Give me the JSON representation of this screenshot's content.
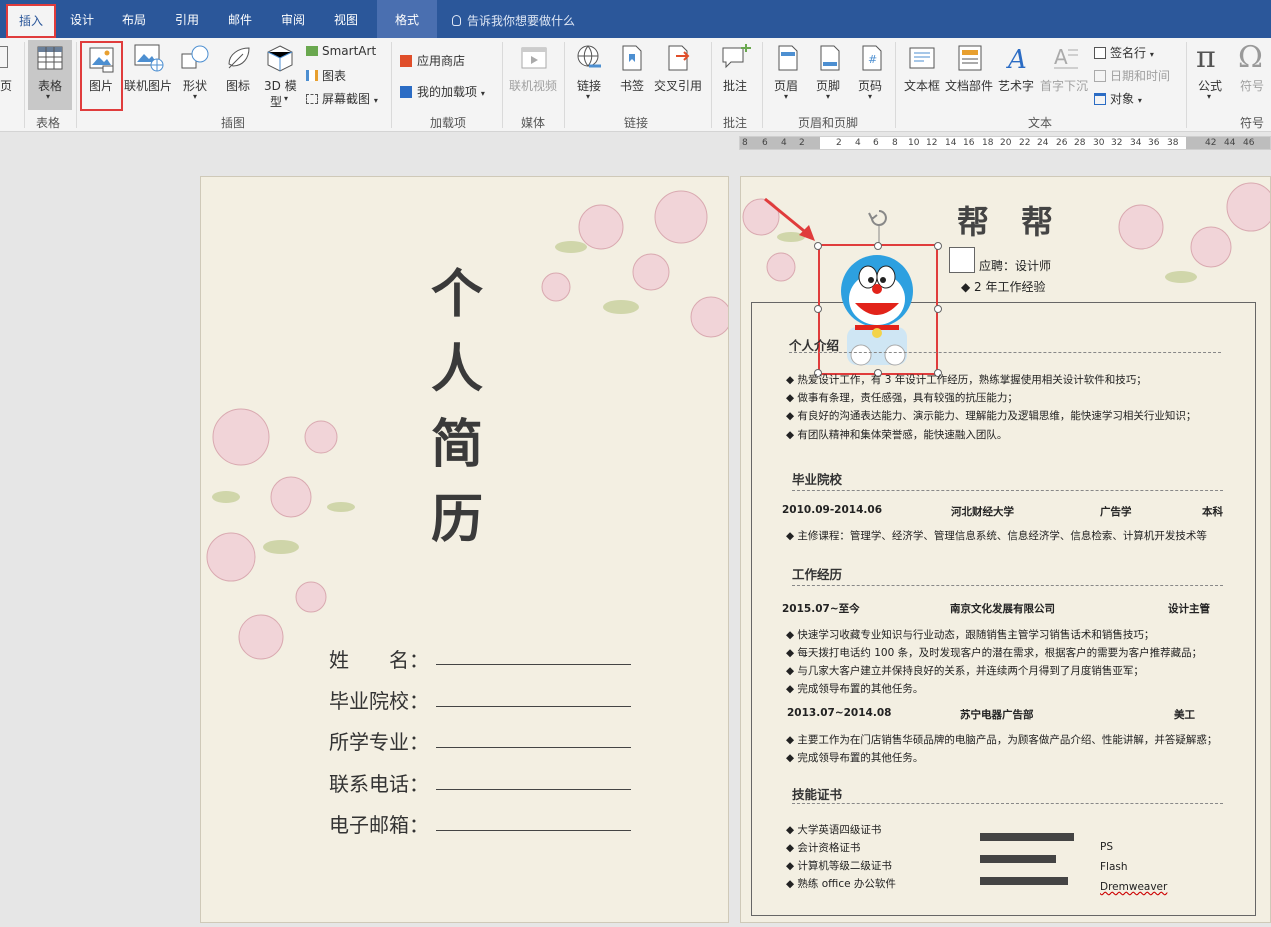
{
  "tabs": [
    {
      "label": "插入",
      "active": true
    },
    {
      "label": "设计"
    },
    {
      "label": "布局"
    },
    {
      "label": "引用"
    },
    {
      "label": "邮件"
    },
    {
      "label": "审阅"
    },
    {
      "label": "视图"
    },
    {
      "label": "格式",
      "contextual": true
    }
  ],
  "tell_me": "告诉我你想要做什么",
  "ribbon": {
    "page_partial": "页",
    "table": "表格",
    "picture": "图片",
    "online_picture": "联机图片",
    "shapes": "形状",
    "icons": "图标",
    "model3d_line1": "3D 模",
    "model3d_line2": "型",
    "smartart": "SmartArt",
    "chart": "图表",
    "screenshot": "屏幕截图",
    "app_store": "应用商店",
    "my_addins": "我的加载项",
    "online_video": "联机视频",
    "link": "链接",
    "bookmark": "书签",
    "cross_ref": "交叉引用",
    "comment": "批注",
    "header": "页眉",
    "footer": "页脚",
    "page_number": "页码",
    "textbox": "文本框",
    "quick_parts": "文档部件",
    "wordart": "艺术字",
    "dropcap": "首字下沉",
    "signature": "签名行",
    "datetime": "日期和时间",
    "object": "对象",
    "equation": "公式",
    "symbol": "符号"
  },
  "groups": {
    "tables": "表格",
    "illustrations": "插图",
    "addins": "加载项",
    "media": "媒体",
    "links": "链接",
    "comments": "批注",
    "header_footer": "页眉和页脚",
    "text": "文本",
    "symbols": "符号"
  },
  "ruler_ticks": [
    "8",
    "6",
    "4",
    "2",
    "2",
    "4",
    "6",
    "8",
    "10",
    "12",
    "14",
    "16",
    "18",
    "20",
    "22",
    "24",
    "26",
    "28",
    "30",
    "32",
    "34",
    "36",
    "38",
    "42",
    "44",
    "46"
  ],
  "cover": {
    "title_chars": [
      "个",
      "人",
      "简",
      "历"
    ],
    "fields": [
      "姓　　名：",
      "毕业院校：",
      "所学专业：",
      "联系电话：",
      "电子邮箱："
    ]
  },
  "resume": {
    "name": "帮　帮",
    "apply": "应聘：设计师",
    "experience": "◆ 2 年工作经验",
    "sections": {
      "intro": "个人介绍",
      "school": "毕业院校",
      "work": "工作经历",
      "skills": "技能证书"
    },
    "intro_items": [
      "◆ 热爱设计工作，有 3 年设计工作经历，熟练掌握使用相关设计软件和技巧；",
      "◆ 做事有条理，责任感强，具有较强的抗压能力；",
      "◆ 有良好的沟通表达能力、演示能力、理解能力及逻辑思维，能快速学习相关行业知识；",
      "◆ 有团队精神和集体荣誉感，能快速融入团队。"
    ],
    "edu": {
      "period": "2010.09-2014.06",
      "school": "河北财经大学",
      "major": "广告学",
      "degree": "本科"
    },
    "courses": "◆ 主修课程：管理学、经济学、管理信息系统、信息经济学、信息检索、计算机开发技术等",
    "jobs": [
      {
        "period": "2015.07~至今",
        "company": "南京文化发展有限公司",
        "title": "设计主管",
        "items": [
          "◆ 快速学习收藏专业知识与行业动态，跟随销售主管学习销售话术和销售技巧；",
          "◆ 每天拨打电话约 100 条，及时发现客户的潜在需求，根据客户的需要为客户推荐藏品；",
          "◆ 与几家大客户建立并保持良好的关系，并连续两个月得到了月度销售亚军；",
          "◆ 完成领导布置的其他任务。"
        ]
      },
      {
        "period": "2013.07~2014.08",
        "company": "苏宁电器广告部",
        "title": "美工",
        "items": [
          "◆ 主要工作为在门店销售华硕品牌的电脑产品，为顾客做产品介绍、性能讲解，并答疑解惑；",
          "◆ 完成领导布置的其他任务。"
        ]
      }
    ],
    "certs": [
      "◆ 大学英语四级证书",
      "◆ 会计资格证书",
      "◆ 计算机等级二级证书",
      "◆ 熟练 office 办公软件"
    ],
    "skill_names": [
      "PS",
      "Flash",
      "Dremweaver"
    ],
    "skill_levels": [
      0.8,
      0.65,
      0.75
    ]
  },
  "colors": {
    "ribbon_blue": "#2b579a",
    "highlight": "#e03c3c"
  }
}
